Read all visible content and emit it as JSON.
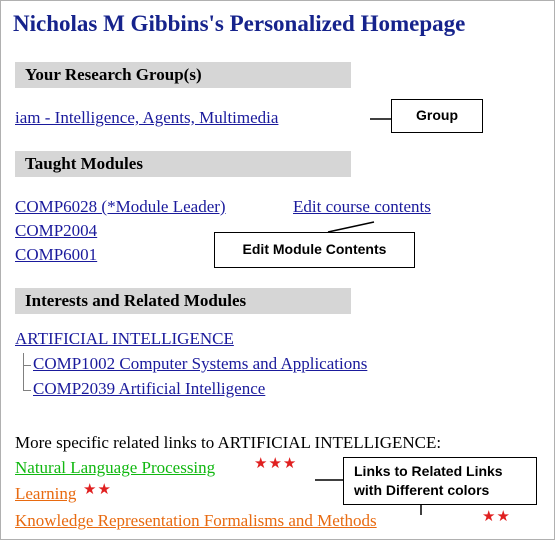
{
  "page": {
    "title": "Nicholas M Gibbins's Personalized Homepage"
  },
  "sections": {
    "research": {
      "heading": "Your Research Group(s)",
      "group_link": "iam - Intelligence, Agents, Multimedia"
    },
    "taught": {
      "heading": "Taught Modules",
      "modules": [
        "COMP6028 (*Module Leader)",
        "COMP2004",
        "COMP6001"
      ],
      "edit_link": "Edit course contents"
    },
    "interests": {
      "heading": "Interests and Related Modules",
      "topic": "ARTIFICIAL INTELLIGENCE",
      "related_modules": [
        "COMP1002 Computer Systems and Applications",
        "COMP2039 Artificial Intelligence"
      ]
    },
    "specific": {
      "intro": "More specific related links to ARTIFICIAL INTELLIGENCE:",
      "links": [
        {
          "label": "Natural Language Processing",
          "color": "#11b811",
          "stars": "★★★"
        },
        {
          "label": "Learning",
          "color": "#e86a10",
          "stars": "★★"
        },
        {
          "label": "Knowledge Representation Formalisms and Methods",
          "color": "#e86a10",
          "stars": "★★"
        }
      ]
    }
  },
  "annotations": {
    "group": "Group",
    "edit": "Edit Module Contents",
    "links_line1": "Links to Related Links",
    "links_line2": "with Different colors"
  },
  "colors": {
    "title": "#16238c",
    "link": "#1a1a9c",
    "section_bg": "#d6d6d6",
    "star": "#e02020"
  }
}
